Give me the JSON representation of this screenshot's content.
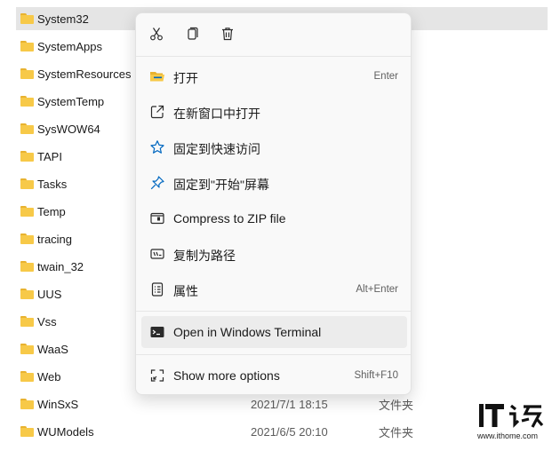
{
  "files": [
    {
      "name": "System32",
      "date": "",
      "type": "",
      "selected": true
    },
    {
      "name": "SystemApps",
      "date": "",
      "type": ""
    },
    {
      "name": "SystemResources",
      "date": "",
      "type": ""
    },
    {
      "name": "SystemTemp",
      "date": "",
      "type": ""
    },
    {
      "name": "SysWOW64",
      "date": "",
      "type": ""
    },
    {
      "name": "TAPI",
      "date": "",
      "type": ""
    },
    {
      "name": "Tasks",
      "date": "",
      "type": ""
    },
    {
      "name": "Temp",
      "date": "",
      "type": ""
    },
    {
      "name": "tracing",
      "date": "",
      "type": ""
    },
    {
      "name": "twain_32",
      "date": "",
      "type": ""
    },
    {
      "name": "UUS",
      "date": "",
      "type": ""
    },
    {
      "name": "Vss",
      "date": "",
      "type": ""
    },
    {
      "name": "WaaS",
      "date": "",
      "type": ""
    },
    {
      "name": "Web",
      "date": "",
      "type": ""
    },
    {
      "name": "WinSxS",
      "date": "2021/7/1 18:15",
      "type": "文件夹"
    },
    {
      "name": "WUModels",
      "date": "2021/6/5 20:10",
      "type": "文件夹"
    }
  ],
  "context_menu": {
    "quick_actions": [
      {
        "icon": "cut-icon"
      },
      {
        "icon": "copy-icon"
      },
      {
        "icon": "delete-icon"
      }
    ],
    "items": [
      {
        "icon": "folder-open-icon",
        "label": "打开",
        "shortcut": "Enter"
      },
      {
        "icon": "open-new-window-icon",
        "label": "在新窗口中打开",
        "shortcut": ""
      },
      {
        "icon": "star-icon",
        "label": "固定到快速访问",
        "shortcut": ""
      },
      {
        "icon": "pin-icon",
        "label": "固定到\"开始\"屏幕",
        "shortcut": ""
      },
      {
        "icon": "zip-icon",
        "label": "Compress to ZIP file",
        "shortcut": ""
      },
      {
        "icon": "copy-path-icon",
        "label": "复制为路径",
        "shortcut": ""
      },
      {
        "icon": "properties-icon",
        "label": "属性",
        "shortcut": "Alt+Enter"
      },
      {
        "icon": "terminal-icon",
        "label": "Open in Windows Terminal",
        "shortcut": "",
        "hover": true
      },
      {
        "icon": "more-options-icon",
        "label": "Show more options",
        "shortcut": "Shift+F10"
      }
    ]
  },
  "watermark": {
    "logo_text": "IT之家",
    "url": "www.ithome.com"
  },
  "colors": {
    "folder": "#f7c948",
    "selection": "#e5e5e5",
    "menu_bg": "#f9f9f9",
    "accent": "#0067c0"
  }
}
